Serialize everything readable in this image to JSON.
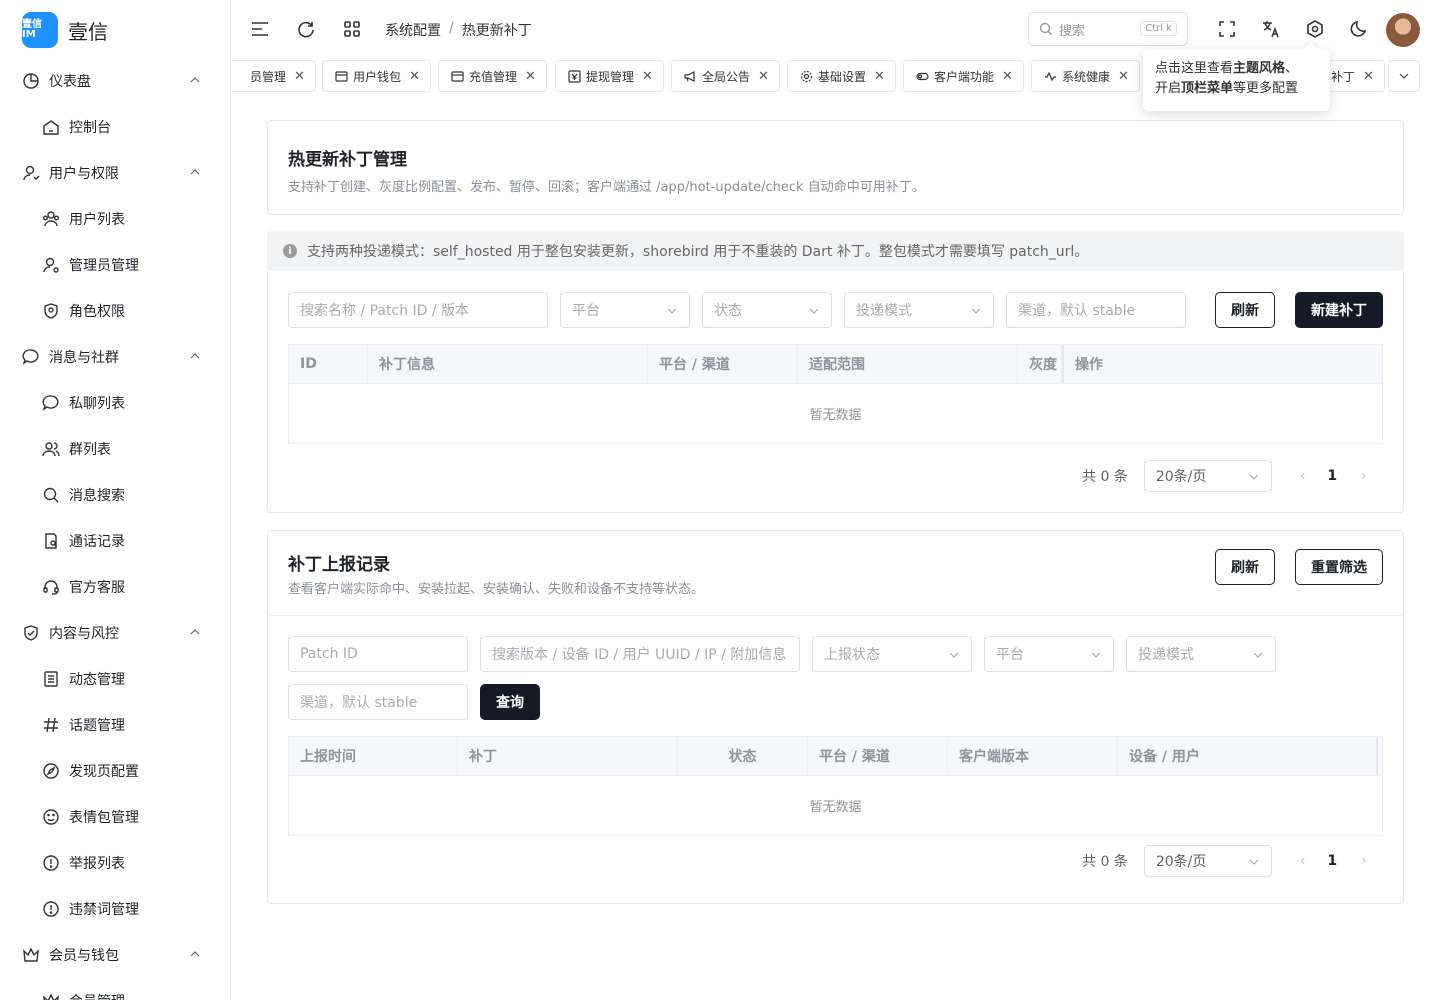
{
  "app": {
    "logo_badge": "壹信 IM",
    "name": "壹信"
  },
  "sidebar": {
    "groups": [
      {
        "label": "仪表盘",
        "icon": "pie-chart-icon",
        "items": [
          {
            "label": "控制台",
            "icon": "home-icon"
          }
        ]
      },
      {
        "label": "用户与权限",
        "icon": "user-icon",
        "items": [
          {
            "label": "用户列表",
            "icon": "users-icon"
          },
          {
            "label": "管理员管理",
            "icon": "admin-icon"
          },
          {
            "label": "角色权限",
            "icon": "shield-icon"
          }
        ]
      },
      {
        "label": "消息与社群",
        "icon": "chat-icon",
        "items": [
          {
            "label": "私聊列表",
            "icon": "chat-bubble-icon"
          },
          {
            "label": "群列表",
            "icon": "group-icon"
          },
          {
            "label": "消息搜索",
            "icon": "search-icon"
          },
          {
            "label": "通话记录",
            "icon": "call-log-icon"
          },
          {
            "label": "官方客服",
            "icon": "headset-icon"
          }
        ]
      },
      {
        "label": "内容与风控",
        "icon": "shield-check-icon",
        "items": [
          {
            "label": "动态管理",
            "icon": "list-icon"
          },
          {
            "label": "话题管理",
            "icon": "hash-icon"
          },
          {
            "label": "发现页配置",
            "icon": "compass-icon"
          },
          {
            "label": "表情包管理",
            "icon": "smile-icon"
          },
          {
            "label": "举报列表",
            "icon": "alert-icon"
          },
          {
            "label": "违禁词管理",
            "icon": "alert-icon"
          }
        ]
      },
      {
        "label": "会员与钱包",
        "icon": "crown-icon",
        "items": [
          {
            "label": "会员管理",
            "icon": "crown-icon"
          }
        ]
      }
    ]
  },
  "header": {
    "breadcrumb": [
      "系统配置",
      "热更新补丁"
    ],
    "breadcrumb_sep": "/",
    "search_placeholder": "搜索",
    "search_kbd": "Ctrl k"
  },
  "tabs": [
    {
      "label": "员管理"
    },
    {
      "label": "用户钱包"
    },
    {
      "label": "充值管理"
    },
    {
      "label": "提现管理"
    },
    {
      "label": "全局公告"
    },
    {
      "label": "基础设置"
    },
    {
      "label": "客户端功能"
    },
    {
      "label": "系统健康"
    },
    {
      "label": "补丁"
    }
  ],
  "tooltip": {
    "line1_pre": "点击这里查看",
    "line1_bold": "主题风格",
    "line1_post": "、",
    "line2_pre": "开启",
    "line2_bold": "顶栏菜单",
    "line2_post": "等更多配置"
  },
  "patch_card": {
    "title": "热更新补丁管理",
    "subtitle": "支持补丁创建、灰度比例配置、发布、暂停、回滚；客户端通过 /app/hot-update/check 自动命中可用补丁。"
  },
  "notice": "支持两种投递模式：self_hosted 用于整包安装更新，shorebird 用于不重装的 Dart 补丁。整包模式才需要填写 patch_url。",
  "patch_filters": {
    "search_placeholder": "搜索名称 / Patch ID / 版本",
    "platform": "平台",
    "status": "状态",
    "mode": "投递模式",
    "channel_placeholder": "渠道，默认 stable",
    "refresh": "刷新",
    "create": "新建补丁"
  },
  "patch_table": {
    "columns": [
      "ID",
      "补丁信息",
      "平台 / 渠道",
      "适配范围",
      "灰度",
      "操作"
    ],
    "empty": "暂无数据"
  },
  "patch_pager": {
    "total": "共 0 条",
    "page_size": "20条/页",
    "page": "1",
    "prev": "‹",
    "next": "›"
  },
  "report_card": {
    "title": "补丁上报记录",
    "subtitle": "查看客户端实际命中、安装拉起、安装确认、失败和设备不支持等状态。",
    "refresh": "刷新",
    "reset": "重置筛选"
  },
  "report_filters": {
    "patch_id_placeholder": "Patch ID",
    "search_placeholder": "搜索版本 / 设备 ID / 用户 UUID / IP / 附加信息",
    "report_status": "上报状态",
    "platform": "平台",
    "mode": "投递模式",
    "channel_placeholder": "渠道，默认 stable",
    "query": "查询"
  },
  "report_table": {
    "columns": [
      "上报时间",
      "补丁",
      "状态",
      "平台 / 渠道",
      "客户端版本",
      "设备 / 用户"
    ],
    "empty": "暂无数据"
  },
  "report_pager": {
    "total": "共 0 条",
    "page_size": "20条/页",
    "page": "1",
    "prev": "‹",
    "next": "›"
  }
}
